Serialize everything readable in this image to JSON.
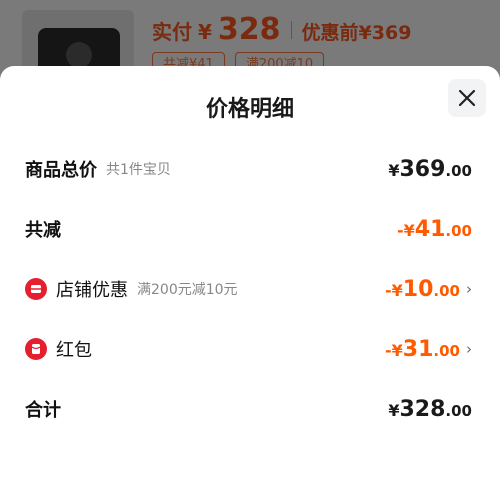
{
  "background": {
    "paid_label": "实付",
    "currency": "¥",
    "paid_value": "328",
    "original_label": "优惠前¥369",
    "tags": [
      "共减¥41",
      "满200减10"
    ]
  },
  "sheet": {
    "title": "价格明细",
    "rows": [
      {
        "label": "商品总价",
        "sub": "共1件宝贝",
        "prefix": "¥",
        "int": "369",
        "dec": ".00",
        "style": "dark"
      },
      {
        "label": "共减",
        "sub": "",
        "prefix": "-¥",
        "int": "41",
        "dec": ".00",
        "style": "orange"
      },
      {
        "label": "店铺优惠",
        "sub": "满200元减10元",
        "prefix": "-¥",
        "int": "10",
        "dec": ".00",
        "style": "orange",
        "icon": "shop-coupon-icon"
      },
      {
        "label": "红包",
        "sub": "",
        "prefix": "-¥",
        "int": "31",
        "dec": ".00",
        "style": "orange",
        "icon": "red-packet-icon"
      },
      {
        "label": "合计",
        "sub": "",
        "prefix": "¥",
        "int": "328",
        "dec": ".00",
        "style": "dark"
      }
    ]
  },
  "colors": {
    "accent": "#ff5a00",
    "coupon_red": "#e51f2d",
    "text": "#1a1a1a"
  }
}
